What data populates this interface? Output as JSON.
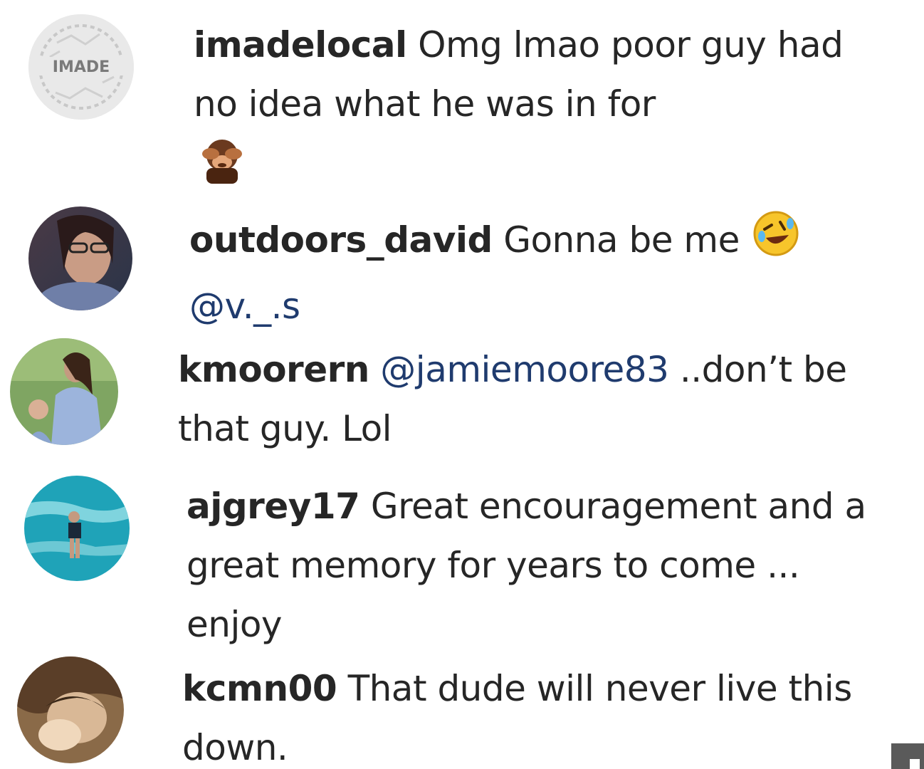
{
  "comments": [
    {
      "username": "imadelocal",
      "text": "Omg lmao poor guy had no idea what he was in for",
      "emoji": "see-no-evil-monkey",
      "avatar_label": "IMADE"
    },
    {
      "username": "outdoors_david",
      "text": "Gonna be me",
      "emoji": "rolling-on-floor-laughing",
      "mention": "@v._.s"
    },
    {
      "username": "kmoorern",
      "mention": "@jamiemoore83",
      "text": "..don’t be that guy. Lol"
    },
    {
      "username": "ajgrey17",
      "text": "Great encouragement and a great memory for years to come ... enjoy"
    },
    {
      "username": "kcmn00",
      "text": "That dude will never live this down."
    }
  ],
  "colors": {
    "text": "#262626",
    "mention": "#1f3b6e",
    "background": "#ffffff"
  }
}
